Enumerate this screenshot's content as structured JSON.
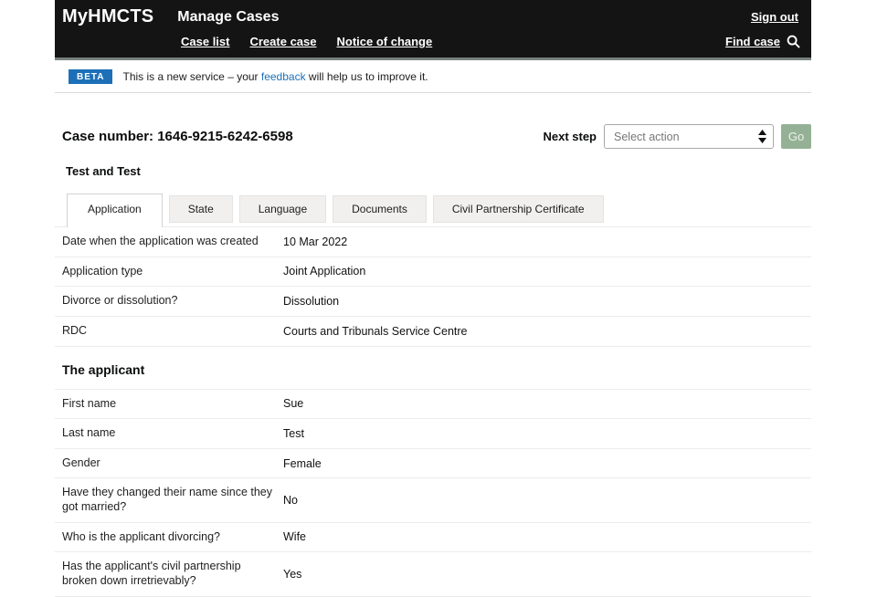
{
  "colors": {
    "header_bg": "#141414",
    "beta_badge": "#1d70b8",
    "link_blue": "#1d70b8",
    "go_button_green": "#95b195",
    "divider": "#ececec"
  },
  "header": {
    "logo": "MyHMCTS",
    "app_title": "Manage Cases",
    "sign_out": "Sign out",
    "nav": [
      "Case list",
      "Create case",
      "Notice of change"
    ],
    "find_case": "Find case",
    "find_case_icon": "search-icon"
  },
  "beta": {
    "badge": "BETA",
    "text_before": "This is a new service – your ",
    "link": "feedback",
    "text_after": " will help us to improve it."
  },
  "case": {
    "case_number": "Case number: 1646-9215-6242-6598",
    "parties": "Test and Test",
    "next_step_label": "Next step",
    "select_value": "Select action",
    "select_icon": "updown-spinner-icon",
    "go_label": "Go"
  },
  "tabs": [
    {
      "label": "Application",
      "active": true
    },
    {
      "label": "State",
      "active": false
    },
    {
      "label": "Language",
      "active": false
    },
    {
      "label": "Documents",
      "active": false
    },
    {
      "label": "Civil Partnership Certificate",
      "active": false
    }
  ],
  "sections": [
    {
      "heading": null,
      "rows": [
        {
          "label": "Date when the application was created",
          "value": "10 Mar 2022"
        },
        {
          "label": "Application type",
          "value": "Joint Application"
        },
        {
          "label": "Divorce or dissolution?",
          "value": "Dissolution"
        },
        {
          "label": "RDC",
          "value": "Courts and Tribunals Service Centre"
        }
      ]
    },
    {
      "heading": "The applicant",
      "rows": [
        {
          "label": "First name",
          "value": "Sue"
        },
        {
          "label": "Last name",
          "value": "Test"
        },
        {
          "label": "Gender",
          "value": "Female"
        },
        {
          "label": "Have they changed their name since they got married?",
          "value": "No"
        },
        {
          "label": "Who is the applicant divorcing?",
          "value": "Wife"
        },
        {
          "label": "Has the applicant's civil partnership broken down irretrievably?",
          "value": "Yes"
        }
      ]
    }
  ]
}
